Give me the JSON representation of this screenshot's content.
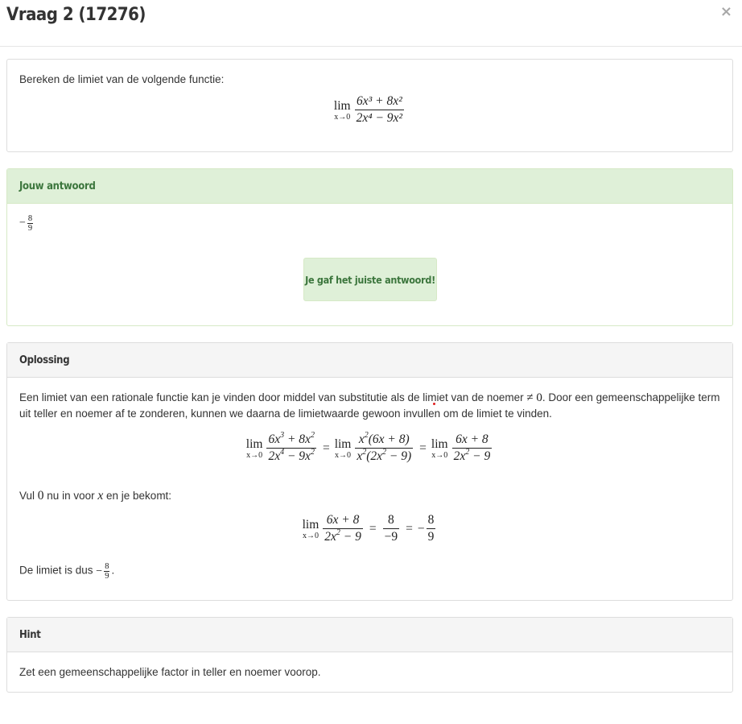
{
  "modal": {
    "title": "Vraag 2 (17276)",
    "close_glyph": "×"
  },
  "question": {
    "prompt": "Bereken de limiet van de volgende functie:",
    "lim_word": "lim",
    "lim_sub": "x→0",
    "numerator": "6x³ + 8x²",
    "denominator": "2x⁴ − 9x²"
  },
  "answer_panel": {
    "heading": "Jouw antwoord",
    "answer_sign": "−",
    "answer_num": "8",
    "answer_den": "9",
    "feedback": "Je gaf het juiste antwoord!"
  },
  "solution_panel": {
    "heading": "Oplossing",
    "para1_a": "Een limiet van een rationale functie kan je vinden door middel van substitutie als de limiet van de noemer",
    "para1_neq": "≠ 0",
    "para1_b": ". Door een gemeenschappelijke term uit teller en noemer af te zonderen, kunnen we daarna de limietwaarde gewoon invullen om de limiet te vinden.",
    "para2_a": "Vul",
    "para2_zero": "0",
    "para2_b": "nu in voor",
    "para2_x": "x",
    "para2_c": "en je bekomt:",
    "conclusion_a": "De limiet is dus",
    "conclusion_sign": "−",
    "conclusion_num": "8",
    "conclusion_den": "9",
    "conclusion_end": "."
  },
  "hint_panel": {
    "heading": "Hint",
    "text": "Zet een gemeenschappelijke factor in teller en noemer voorop."
  },
  "colors": {
    "success_bg": "#dff0d8",
    "success_border": "#d6e9c6",
    "success_text": "#3c763d",
    "panel_head_bg": "#f5f5f5",
    "panel_border": "#dddddd"
  }
}
